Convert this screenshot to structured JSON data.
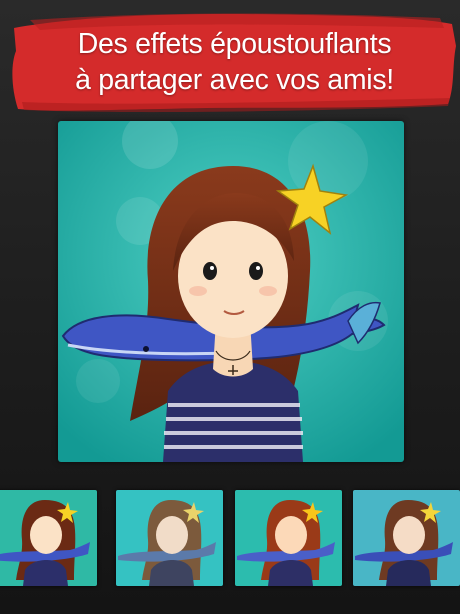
{
  "banner": {
    "headline_line1": "Des effets époustouflants",
    "headline_line2": "à partager avec vos amis!",
    "brush_color": "#d42b2b"
  },
  "artwork": {
    "icon": "girl-with-whale-illustration",
    "background_color": "#20b3a8"
  },
  "thumbnails": [
    {
      "filter": "original",
      "background_color": "#2fb9a5"
    },
    {
      "filter": "muted",
      "background_color": "#35c2c2"
    },
    {
      "filter": "warm",
      "background_color": "#2cbcae"
    },
    {
      "filter": "cool",
      "background_color": "#49b6c6"
    }
  ]
}
